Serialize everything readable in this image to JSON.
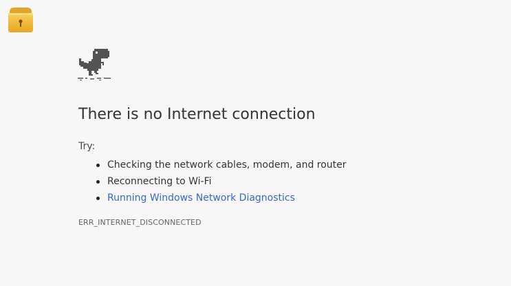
{
  "app_icon": {
    "name": "lock-folder-icon",
    "color": "#f2b533"
  },
  "dino_icon": {
    "name": "dinosaur-icon",
    "color": "#535353"
  },
  "error_page": {
    "title": "There is no Internet connection",
    "try_label": "Try:",
    "suggestions": [
      {
        "label": "Checking the network cables, modem, and router"
      },
      {
        "label": "Reconnecting to Wi-Fi"
      },
      {
        "label": "Running Windows Network Diagnostics"
      }
    ],
    "error_code": "ERR_INTERNET_DISCONNECTED"
  },
  "colors": {
    "background": "#f7f7f7",
    "text": "#333333",
    "link": "#3a66c8"
  }
}
